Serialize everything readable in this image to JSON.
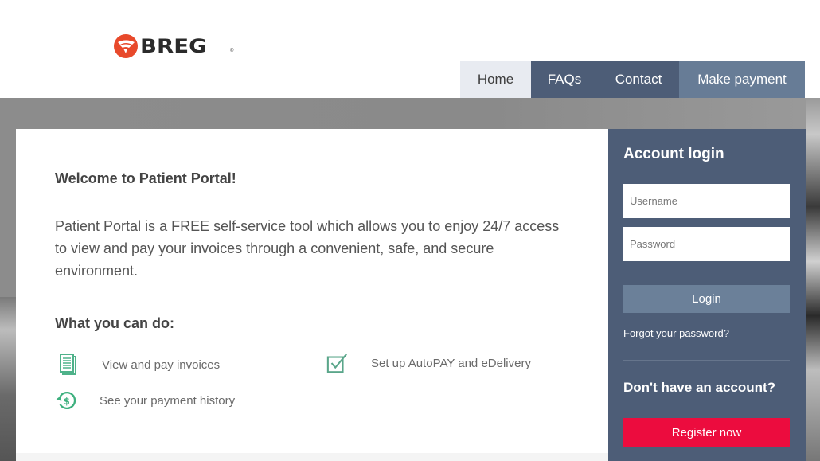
{
  "brand": {
    "name": "BREG",
    "reg_mark": "®",
    "accent": "#e8492b"
  },
  "nav": {
    "home": "Home",
    "faqs": "FAQs",
    "contact": "Contact",
    "make_payment": "Make payment"
  },
  "main": {
    "welcome_title": "Welcome to Patient Portal!",
    "intro": "Patient Portal is a FREE self-service tool which allows you to enjoy 24/7 access to view and pay your invoices through a convenient, safe, and secure environment.",
    "can_do_title": "What you can do:",
    "features": [
      {
        "icon": "document-icon",
        "label": "View and pay invoices"
      },
      {
        "icon": "checkbox-icon",
        "label": "Set up AutoPAY and eDelivery"
      },
      {
        "icon": "payment-history-icon",
        "label": "See your payment history"
      }
    ]
  },
  "login": {
    "title": "Account login",
    "username_placeholder": "Username",
    "password_placeholder": "Password",
    "username_value": "",
    "password_value": "",
    "login_label": "Login",
    "forgot_label": "Forgot your password?",
    "no_account_title": "Don't have an account?",
    "register_label": "Register now"
  },
  "colors": {
    "nav_dark": "#4d5d77",
    "nav_light": "#677c96",
    "panel": "#4d5d77",
    "register": "#ec0c3e",
    "feature_icon": "#4fb28a"
  }
}
